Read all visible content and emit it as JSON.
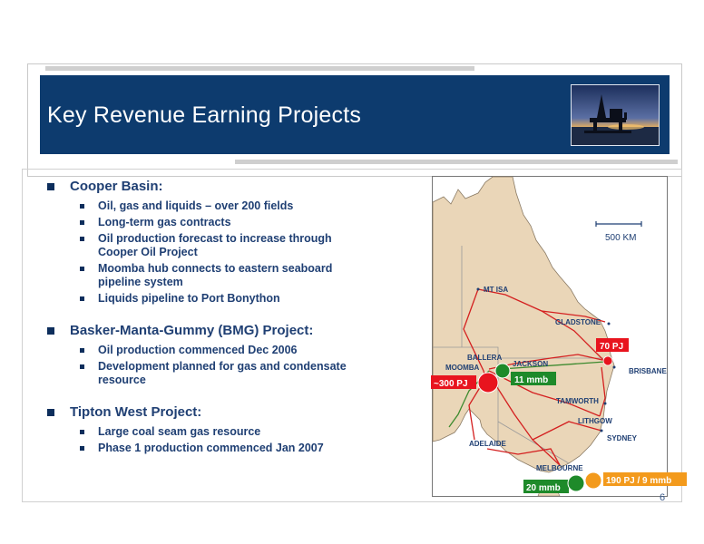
{
  "header": {
    "title": "Key Revenue Earning Projects",
    "photo": "offshore-oil-rig-at-sunset"
  },
  "sections": [
    {
      "heading": "Cooper Basin:",
      "items": [
        "Oil, gas and liquids – over 200 fields",
        "Long-term gas contracts",
        "Oil production forecast to increase through Cooper Oil Project",
        "Moomba hub connects to eastern seaboard pipeline system",
        "Liquids pipeline to Port Bonython"
      ]
    },
    {
      "heading": "Basker-Manta-Gummy (BMG) Project:",
      "items": [
        "Oil production commenced Dec 2006",
        "Development planned for gas and condensate resource"
      ]
    },
    {
      "heading": "Tipton West Project:",
      "items": [
        "Large coal seam gas resource",
        "Phase 1 production commenced Jan 2007"
      ]
    }
  ],
  "map": {
    "scale_label": "500 KM",
    "cities": {
      "mt_isa": "MT ISA",
      "gladstone": "GLADSTONE",
      "ballera": "BALLERA",
      "jackson": "JACKSON",
      "moomba": "MOOMBA",
      "brisbane": "BRISBANE",
      "tamworth": "TAMWORTH",
      "lithgow": "LITHGOW",
      "sydney": "SYDNEY",
      "adelaide": "ADELAIDE",
      "melbourne": "MELBOURNE"
    },
    "callouts": {
      "tipton": "70 PJ",
      "cooper_gas": "~300 PJ",
      "cooper_oil": "11 mmb",
      "bmg_gas": "190 PJ / 9 mmb",
      "bmg_oil": "20 mmb"
    },
    "colors": {
      "land": "#ead6b8",
      "sea": "#ffffff",
      "pipeline": "#d42020",
      "liquids_pipeline": "#3c8a2e",
      "gas_marker": "#e8141e",
      "oil_marker": "#1e8a2a",
      "bmg_marker": "#f39a1c"
    }
  },
  "page_number": "6"
}
